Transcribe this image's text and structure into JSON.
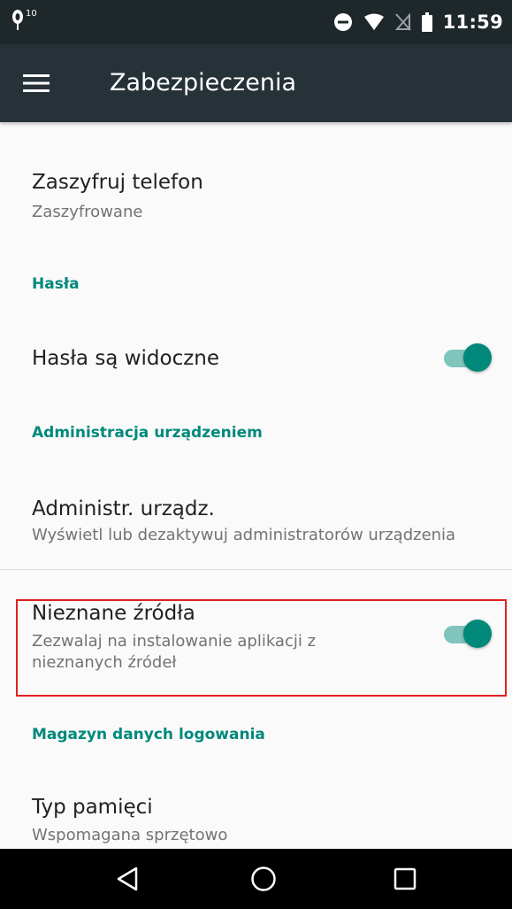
{
  "status_bar": {
    "badge": "10",
    "time": "11:59",
    "icons": [
      "mic-notification-icon",
      "do-not-disturb-icon",
      "wifi-icon",
      "no-sim-icon",
      "battery-icon"
    ]
  },
  "app_bar": {
    "title": "Zabezpieczenia",
    "menu_icon": "hamburger-menu-icon"
  },
  "settings": {
    "encrypt": {
      "title": "Zaszyfruj telefon",
      "summary": "Zaszyfrowane"
    },
    "passwords_header": "Hasła",
    "show_passwords": {
      "title": "Hasła są widoczne",
      "enabled": true
    },
    "device_admin_header": "Administracja urządzeniem",
    "device_admins": {
      "title": "Administr. urządz.",
      "summary": "Wyświetl lub dezaktywuj administratorów urządzenia"
    },
    "unknown_sources": {
      "title": "Nieznane źródła",
      "summary_line1": "Zezwalaj na instalowanie aplikacji z",
      "summary_line2": "nieznanych źródeł",
      "enabled": true
    },
    "credential_header": "Magazyn danych logowania",
    "storage_type": {
      "title": "Typ pamięci",
      "summary": "Wspomagana sprzętowo"
    }
  },
  "colors": {
    "accent": "#00897b",
    "toolbar": "#263238",
    "highlight": "#e02020"
  },
  "nav_bar": {
    "buttons": [
      "back-icon",
      "home-icon",
      "recents-icon"
    ]
  }
}
